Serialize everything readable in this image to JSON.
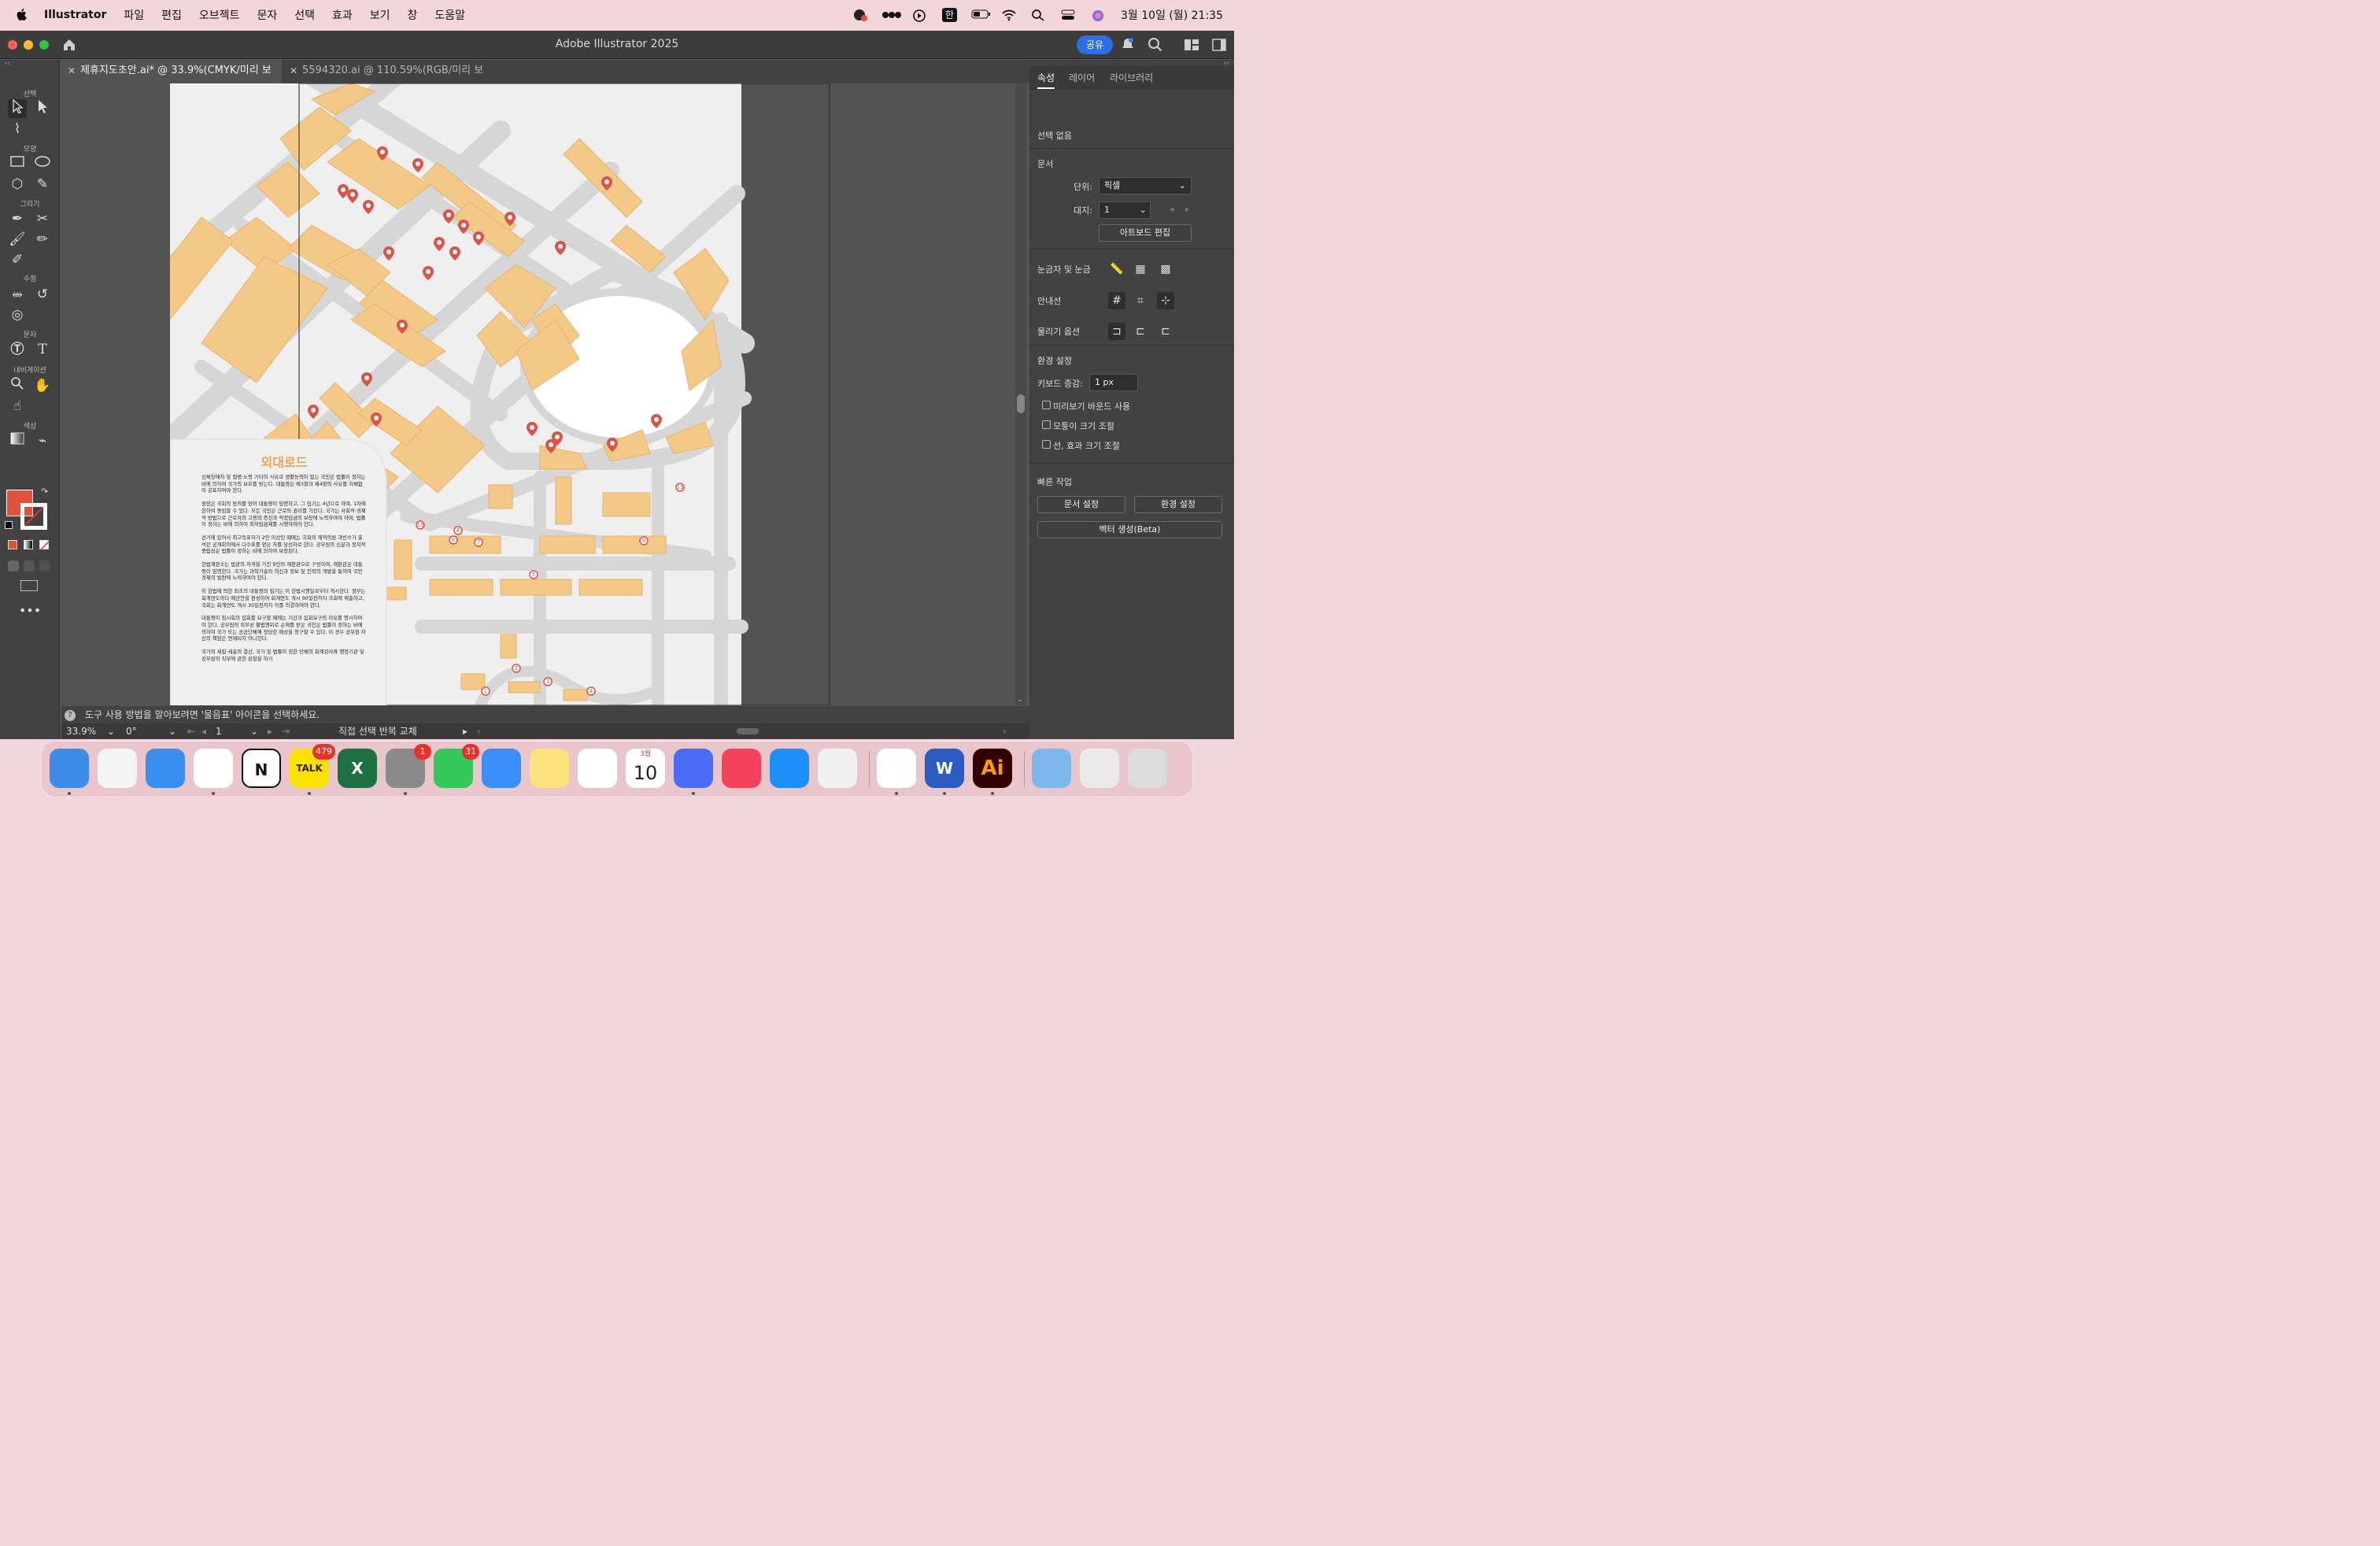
{
  "menubar": {
    "app_name": "Illustrator",
    "items": [
      "파일",
      "편집",
      "오브젝트",
      "문자",
      "선택",
      "효과",
      "보기",
      "창",
      "도움말"
    ],
    "input_method": "한",
    "datetime": "3월 10일 (월) 21:35"
  },
  "window": {
    "title": "Adobe Illustrator 2025",
    "share_label": "공유",
    "tabs": [
      {
        "label": "제휴지도초안.ai* @ 33.9%(CMYK/미리 보기)",
        "active": true
      },
      {
        "label": "5594320.ai @ 110.59%(RGB/미리 보기)",
        "active": false
      }
    ]
  },
  "toolbar": {
    "sections": [
      "선택",
      "모양",
      "그리기",
      "수정",
      "문자",
      "내비게이션",
      "색상"
    ],
    "fill_color": "#e0503c"
  },
  "document": {
    "map_title": "외대로드",
    "paragraphs": [
      "신체장애자 및 질병·노령 기타의 사유로 생활능력이 없는 국민은 법률이 정하는 바에 의하여 국가의 보호를 받는다. 대통령은 제3항과 제4항의 사유를 지체없이 공포하여야 한다.",
      "원장은 국회의 동의를 얻어 대통령이 임명하고, 그 임기는 4년으로 하며, 1차에 한하여 중임할 수 있다. 모든 국민은 근로의 권리를 가진다. 국가는 사회적·경제적 방법으로 근로자의 고용의 증진과 적정임금의 보장에 노력하여야 하며, 법률이 정하는 바에 의하여 최저임금제를 시행하여야 한다.",
      "선거에 있어서 최고득표자가 2인 이상인 때에는 국회의 재적의원 과반수가 출석한 공개회의에서 다수표를 얻은 자를 당선자로 한다. 공무원의 신분과 정치적 중립성은 법률이 정하는 바에 의하여 보장된다.",
      "헌법재판소는 법관의 자격을 가진 9인의 재판관으로 구성하며, 재판관은 대통령이 임명한다. 국가는 과학기술의 혁신과 정보 및 인력의 개발을 통하여 국민경제의 발전에 노력하여야 한다.",
      "이 헌법에 의한 최초의 대통령의 임기는 이 헌법시행일로부터 개시한다. 정부는 회계연도마다 예산안을 편성하여 회계연도 개시 90일전까지 국회에 제출하고, 국회는 회계연도 개시 30일전까지 이를 의결하여야 한다.",
      "대통령이 임시회의 집회를 요구할 때에는 기간과 집회요구의 이유를 명시하여야 한다. 공무원의 직무상 불법행위로 손해를 받은 국민은 법률이 정하는 바에 의하여 국가 또는 공공단체에 정당한 배상을 청구할 수 있다. 이 경우 공무원 자신의 책임은 면제되지 아니한다.",
      "국가의 세입·세출의 결산, 국가 및 법률이 정한 단체의 회계검사와 행정기관 및 공무원의 직무에 관한 감찰을 하기"
    ],
    "numbered_pins": [
      "1",
      "2",
      "3",
      "4",
      "5",
      "6",
      "7",
      "8",
      "9",
      "10",
      "11"
    ],
    "colors": {
      "building": "#f4c987",
      "road": "#d8d8d8",
      "block": "#efefef",
      "pin": "#d9544a",
      "title": "#f0a24a"
    }
  },
  "statusbar": {
    "hint": "도구 사용 방법을 알아보려면 '물음표' 아이콘을 선택하세요.",
    "zoom": "33.9%",
    "rotation": "0°",
    "artboard": "1",
    "mode": "직접 선택 반복 교체"
  },
  "properties": {
    "tabs": [
      "속성",
      "레이어",
      "라이브러리"
    ],
    "selection": "선택 없음",
    "document_label": "문서",
    "unit_label": "단위:",
    "unit_value": "픽셀",
    "artboard_label": "대지:",
    "artboard_value": "1",
    "edit_artboard": "아트보드 편집",
    "rulers_grids": "눈금자 및 눈금",
    "guides": "안내선",
    "snap_options": "물리기 옵션",
    "preferences": "환경 설정",
    "keyboard_increment_label": "키보드 증감:",
    "keyboard_increment_value": "1 px",
    "checkboxes": [
      "미리보기 바운드 사용",
      "모퉁이 크기 조절",
      "선, 효과 크기 조절"
    ],
    "quick_actions": "빠른 작업",
    "doc_setup": "문서 설정",
    "pref_button": "환경 설정",
    "vector_gen": "벡터 생성(Beta)"
  },
  "dock": {
    "apps": [
      {
        "name": "Finder",
        "label": "",
        "color": "#3d8de8",
        "badge": ""
      },
      {
        "name": "Launchpad",
        "label": "",
        "color": "#f5f5f5",
        "badge": ""
      },
      {
        "name": "Safari",
        "label": "",
        "color": "#3a8ef0",
        "badge": ""
      },
      {
        "name": "Slack",
        "label": "",
        "color": "#ffffff",
        "badge": ""
      },
      {
        "name": "Notion",
        "label": "N",
        "color": "#ffffff",
        "badge": ""
      },
      {
        "name": "KakaoTalk",
        "label": "TALK",
        "color": "#fae100",
        "badge": "479"
      },
      {
        "name": "Excel",
        "label": "X",
        "color": "#1d7044",
        "badge": ""
      },
      {
        "name": "System Settings",
        "label": "",
        "color": "#8a8a8a",
        "badge": "1"
      },
      {
        "name": "Messages",
        "label": "",
        "color": "#35c759",
        "badge": "31"
      },
      {
        "name": "Mail",
        "label": "",
        "color": "#3b8ef5",
        "badge": ""
      },
      {
        "name": "Notes",
        "label": "",
        "color": "#fbe27a",
        "badge": ""
      },
      {
        "name": "Photos",
        "label": "",
        "color": "#ffffff",
        "badge": ""
      },
      {
        "name": "Calendar",
        "label": "10",
        "color": "#ffffff",
        "badge": ""
      },
      {
        "name": "Clova",
        "label": "",
        "color": "#4a6cf7",
        "badge": ""
      },
      {
        "name": "Music",
        "label": "",
        "color": "#f6405c",
        "badge": ""
      },
      {
        "name": "App Store",
        "label": "",
        "color": "#1e8ef8",
        "badge": ""
      },
      {
        "name": "iPhone Mirroring",
        "label": "",
        "color": "#f0f0f0",
        "badge": ""
      },
      {
        "name": "Chrome",
        "label": "",
        "color": "#ffffff",
        "badge": ""
      },
      {
        "name": "Word",
        "label": "W",
        "color": "#2b5cc0",
        "badge": ""
      },
      {
        "name": "Illustrator",
        "label": "Ai",
        "color": "#330000",
        "badge": ""
      },
      {
        "name": "Folder",
        "label": "",
        "color": "#7cb8ec",
        "badge": ""
      },
      {
        "name": "Preview",
        "label": "",
        "color": "#e9e9e9",
        "badge": ""
      },
      {
        "name": "Trash",
        "label": "",
        "color": "#dcdcdc",
        "badge": ""
      }
    ],
    "calendar_month": "3월"
  }
}
